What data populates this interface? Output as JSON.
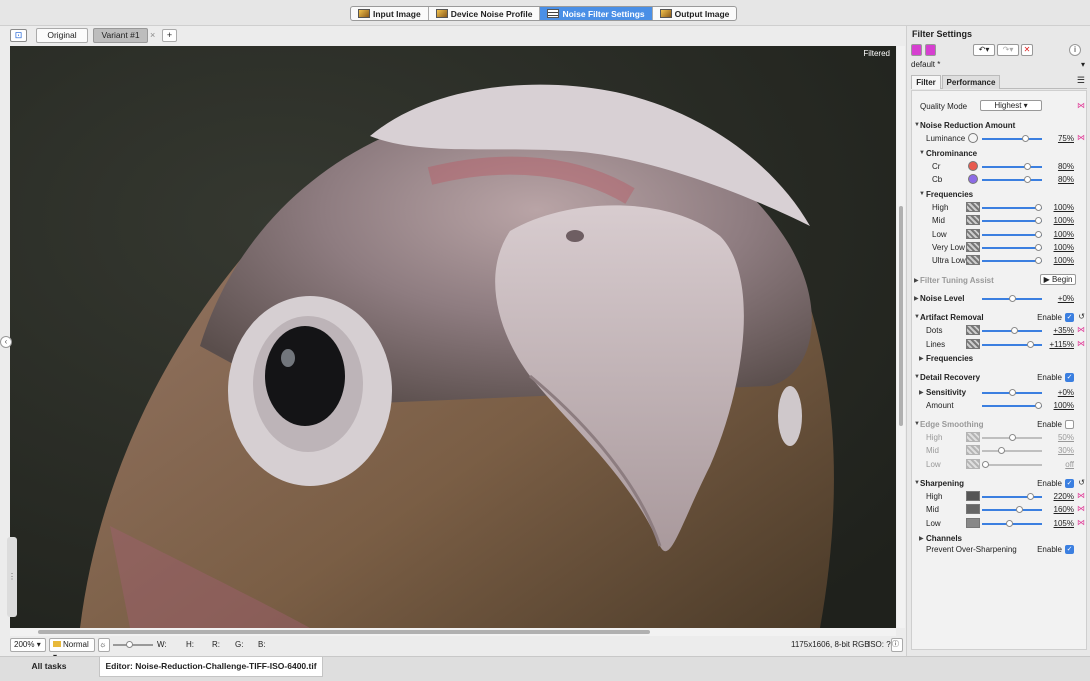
{
  "wizard_tabs": [
    {
      "label": "Input Image",
      "icon": "photo-icon"
    },
    {
      "label": "Device Noise Profile",
      "icon": "photo-icon"
    },
    {
      "label": "Noise Filter Settings",
      "icon": "sliders-icon"
    },
    {
      "label": "Output Image",
      "icon": "photo-icon"
    }
  ],
  "viewer": {
    "original_label": "Original",
    "variant_label": "Variant #1",
    "close_glyph": "×",
    "add_glyph": "+",
    "overlay_label": "Filtered"
  },
  "status": {
    "zoom": "200%",
    "mode": "Normal",
    "w": "W:",
    "h": "H:",
    "r": "R:",
    "g": "G:",
    "b": "B:",
    "dims": "1175x1606, 8-bit RGB",
    "iso": "ISO: ?"
  },
  "bottom_tabs": {
    "all_tasks": "All tasks",
    "editor": "Editor: Noise-Reduction-Challenge-TIFF-ISO-6400.tif"
  },
  "panel": {
    "title": "Filter Settings",
    "preset": "default *",
    "tabs": [
      "Filter",
      "Performance"
    ],
    "quality_label": "Quality Mode",
    "quality_value": "Highest",
    "noise_reduction": "Noise Reduction Amount",
    "luminance_label": "Luminance",
    "luminance": "75%",
    "chrominance": "Chrominance",
    "cr_label": "Cr",
    "cr": "80%",
    "cb_label": "Cb",
    "cb": "80%",
    "frequencies": "Frequencies",
    "freq": [
      {
        "label": "High",
        "value": "100%"
      },
      {
        "label": "Mid",
        "value": "100%"
      },
      {
        "label": "Low",
        "value": "100%"
      },
      {
        "label": "Very Low",
        "value": "100%"
      },
      {
        "label": "Ultra Low",
        "value": "100%"
      }
    ],
    "tuning_assist": "Filter Tuning Assist",
    "begin": "Begin",
    "noise_level_label": "Noise Level",
    "noise_level": "+0%",
    "artifact_removal": "Artifact Removal",
    "enable": "Enable",
    "dots_label": "Dots",
    "dots": "+35%",
    "lines_label": "Lines",
    "lines": "+115%",
    "artifact_frequencies": "Frequencies",
    "detail_recovery": "Detail Recovery",
    "sensitivity_label": "Sensitivity",
    "sensitivity": "+0%",
    "amount_label": "Amount",
    "amount": "100%",
    "edge_smoothing": "Edge Smoothing",
    "edge": [
      {
        "label": "High",
        "value": "50%"
      },
      {
        "label": "Mid",
        "value": "30%"
      },
      {
        "label": "Low",
        "value": "off"
      }
    ],
    "sharpening": "Sharpening",
    "sharp": [
      {
        "label": "High",
        "value": "220%"
      },
      {
        "label": "Mid",
        "value": "160%"
      },
      {
        "label": "Low",
        "value": "105%"
      }
    ],
    "channels": "Channels",
    "prevent_label": "Prevent Over-Sharpening",
    "slider_levels": {
      "luminance": 0.75,
      "cr": 0.8,
      "cb": 0.8,
      "freq": 1.0,
      "noise_level": 0.5,
      "dots": 0.55,
      "lines": 0.85,
      "sensitivity": 0.5,
      "amount": 1.0,
      "edge_high": 0.5,
      "edge_mid": 0.3,
      "edge_low": 0.0,
      "sharp_high": 0.85,
      "sharp_mid": 0.65,
      "sharp_low": 0.45,
      "status_zoom": 0.4
    },
    "colors": {
      "accent": "#3b7fe0",
      "cr_dot": "#e85b4f",
      "cb_dot": "#8c6be6",
      "pin": "#e0409a"
    }
  }
}
